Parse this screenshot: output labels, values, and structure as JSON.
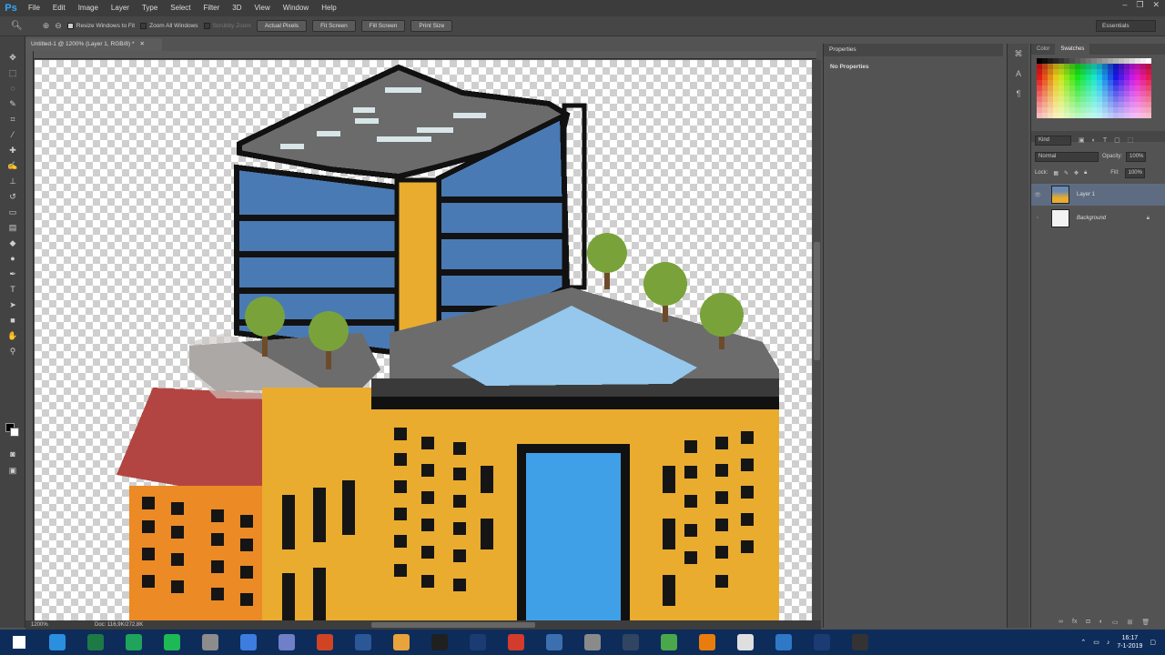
{
  "app": {
    "logo": "Ps"
  },
  "menu": [
    "File",
    "Edit",
    "Image",
    "Layer",
    "Type",
    "Select",
    "Filter",
    "3D",
    "View",
    "Window",
    "Help"
  ],
  "options": {
    "resize_windows": "Resize Windows to Fit",
    "zoom_all": "Zoom All Windows",
    "scrubby": "Scrubby Zoom",
    "actual_pixels": "Actual Pixels",
    "fit_screen": "Fit Screen",
    "fill_screen": "Fill Screen",
    "print_size": "Print Size",
    "workspace": "Essentials"
  },
  "document": {
    "tab_title": "Untitled-1 @ 1200% (Layer 1, RGB/8) *"
  },
  "status": {
    "zoom": "1200%",
    "doc": "Doc: 116,9K/272,8K"
  },
  "properties": {
    "tab": "Properties",
    "body": "No Properties"
  },
  "color_panel": {
    "tab_color": "Color",
    "tab_swatches": "Swatches"
  },
  "layers": {
    "kind": "Kind",
    "blend": "Normal",
    "opacity_label": "Opacity:",
    "opacity": "100%",
    "lock_label": "Lock:",
    "fill_label": "Fill:",
    "fill": "100%",
    "items": [
      {
        "name": "Layer 1"
      },
      {
        "name": "Background"
      }
    ]
  },
  "taskbar": {
    "apps": [
      {
        "name": "windows-icon",
        "color": "#ffffff"
      },
      {
        "name": "edge-icon",
        "color": "#2b8fe0"
      },
      {
        "name": "excel-icon",
        "color": "#1d7a44"
      },
      {
        "name": "sheets-icon",
        "color": "#20a35a"
      },
      {
        "name": "spotify-icon",
        "color": "#1db954"
      },
      {
        "name": "settings-app-icon",
        "color": "#8c8c8c"
      },
      {
        "name": "shield-app-icon",
        "color": "#3d7de0"
      },
      {
        "name": "discord-icon",
        "color": "#6f7fc8"
      },
      {
        "name": "powerpoint-icon",
        "color": "#d04423"
      },
      {
        "name": "word-icon",
        "color": "#2b5797"
      },
      {
        "name": "chrome-icon",
        "color": "#e8a33a"
      },
      {
        "name": "obs-icon",
        "color": "#202020"
      },
      {
        "name": "photoshop-icon",
        "color": "#1b3b73"
      },
      {
        "name": "game-app-icon",
        "color": "#d33b2c"
      },
      {
        "name": "app-icon",
        "color": "#3b6fb0"
      },
      {
        "name": "uplay-icon",
        "color": "#8a8a8a"
      },
      {
        "name": "steam-icon",
        "color": "#314563"
      },
      {
        "name": "vpn-icon",
        "color": "#4aa84a"
      },
      {
        "name": "blender-icon",
        "color": "#e87d0d"
      },
      {
        "name": "files-icon",
        "color": "#dfdfdf"
      },
      {
        "name": "mail-icon",
        "color": "#2f78c6"
      },
      {
        "name": "photoshop-active-icon",
        "color": "#1b3b73"
      },
      {
        "name": "obs-app-icon",
        "color": "#333333"
      }
    ],
    "time": "16:17",
    "date": "7-1-2019"
  }
}
